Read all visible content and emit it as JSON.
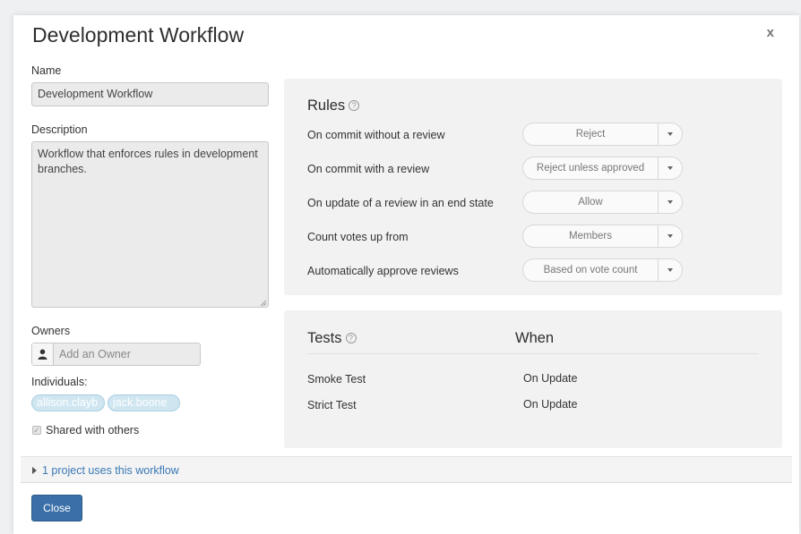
{
  "dialog": {
    "title": "Development Workflow",
    "close_glyph": "x"
  },
  "form": {
    "name_label": "Name",
    "name_value": "Development Workflow",
    "description_label": "Description",
    "description_value": "Workflow that enforces rules in development branches.",
    "owners_label": "Owners",
    "owner_placeholder": "Add an Owner",
    "individuals_label": "Individuals:",
    "individuals": [
      "allison.clayb",
      "jack.boone"
    ],
    "shared_label": "Shared with others",
    "shared_checked": true
  },
  "rules": {
    "heading": "Rules",
    "help_glyph": "?",
    "items": [
      {
        "label": "On commit without a review",
        "value": "Reject"
      },
      {
        "label": "On commit with a review",
        "value": "Reject unless approved"
      },
      {
        "label": "On update of a review in an end state",
        "value": "Allow"
      },
      {
        "label": "Count votes up from",
        "value": "Members"
      },
      {
        "label": "Automatically approve reviews",
        "value": "Based on vote count"
      }
    ]
  },
  "tests": {
    "heading": "Tests",
    "when_heading": "When",
    "help_glyph": "?",
    "rows": [
      {
        "name": "Smoke Test",
        "when": "On Update"
      },
      {
        "name": "Strict Test",
        "when": "On Update"
      }
    ]
  },
  "footer": {
    "projects_link": "1 project uses this workflow",
    "close_label": "Close"
  },
  "colors": {
    "primary_button": "#3a6fa8",
    "link": "#3a78b5",
    "chip_bg": "#cfe6f1"
  }
}
